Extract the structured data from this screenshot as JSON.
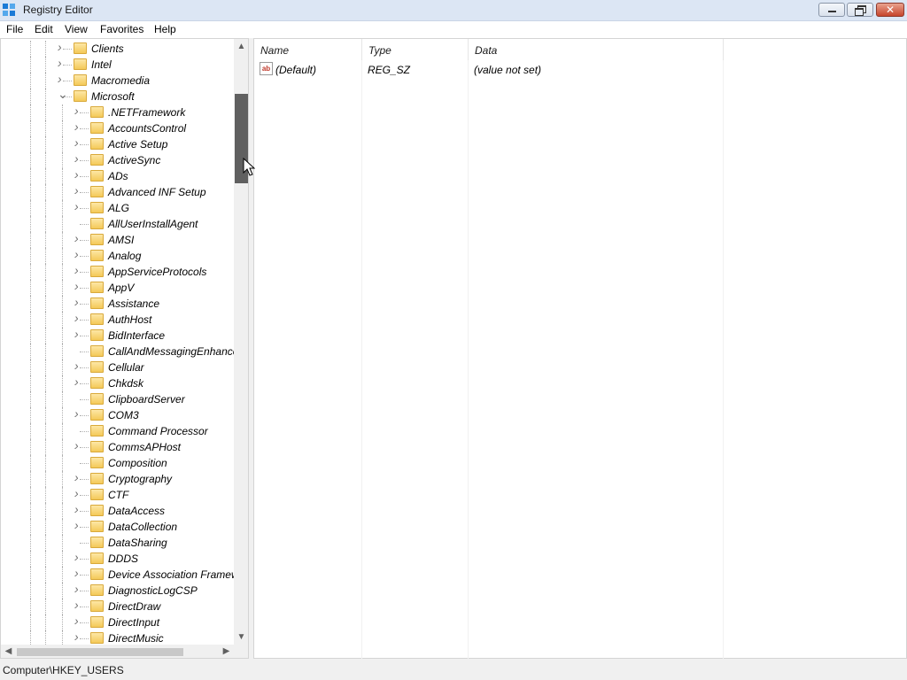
{
  "window": {
    "title": "Registry Editor",
    "close_glyph": "✕",
    "icon": "registry-editor-icon"
  },
  "menu": {
    "file": "File",
    "edit": "Edit",
    "view": "View",
    "favorites": "Favorites",
    "help": "Help"
  },
  "tree": {
    "parent_items": [
      {
        "label": "Clients",
        "state": "collapsed"
      },
      {
        "label": "Intel",
        "state": "collapsed"
      },
      {
        "label": "Macromedia",
        "state": "collapsed"
      },
      {
        "label": "Microsoft",
        "state": "expanded"
      }
    ],
    "child_items": [
      {
        "label": ".NETFramework",
        "expandable": true
      },
      {
        "label": "AccountsControl",
        "expandable": true
      },
      {
        "label": "Active Setup",
        "expandable": true
      },
      {
        "label": "ActiveSync",
        "expandable": true
      },
      {
        "label": "ADs",
        "expandable": true
      },
      {
        "label": "Advanced INF Setup",
        "expandable": true
      },
      {
        "label": "ALG",
        "expandable": true
      },
      {
        "label": "AllUserInstallAgent",
        "expandable": false
      },
      {
        "label": "AMSI",
        "expandable": true
      },
      {
        "label": "Analog",
        "expandable": true
      },
      {
        "label": "AppServiceProtocols",
        "expandable": true
      },
      {
        "label": "AppV",
        "expandable": true
      },
      {
        "label": "Assistance",
        "expandable": true
      },
      {
        "label": "AuthHost",
        "expandable": true
      },
      {
        "label": "BidInterface",
        "expandable": true
      },
      {
        "label": "CallAndMessagingEnhance",
        "expandable": false
      },
      {
        "label": "Cellular",
        "expandable": true
      },
      {
        "label": "Chkdsk",
        "expandable": true
      },
      {
        "label": "ClipboardServer",
        "expandable": false
      },
      {
        "label": "COM3",
        "expandable": true
      },
      {
        "label": "Command Processor",
        "expandable": false
      },
      {
        "label": "CommsAPHost",
        "expandable": true
      },
      {
        "label": "Composition",
        "expandable": false
      },
      {
        "label": "Cryptography",
        "expandable": true
      },
      {
        "label": "CTF",
        "expandable": true
      },
      {
        "label": "DataAccess",
        "expandable": true
      },
      {
        "label": "DataCollection",
        "expandable": true
      },
      {
        "label": "DataSharing",
        "expandable": false
      },
      {
        "label": "DDDS",
        "expandable": true
      },
      {
        "label": "Device Association Framew",
        "expandable": true
      },
      {
        "label": "DiagnosticLogCSP",
        "expandable": true
      },
      {
        "label": "DirectDraw",
        "expandable": true
      },
      {
        "label": "DirectInput",
        "expandable": true
      },
      {
        "label": "DirectMusic",
        "expandable": true
      }
    ]
  },
  "values": {
    "columns": {
      "name": "Name",
      "type": "Type",
      "data": "Data"
    },
    "rows": [
      {
        "name": "(Default)",
        "type": "REG_SZ",
        "data": "(value not set)",
        "icon": "string-value-icon",
        "icon_glyph": "ab"
      }
    ]
  },
  "status": {
    "path": "Computer\\HKEY_USERS"
  },
  "colors": {
    "folder": "#f4c958",
    "scrollbar_thumb": "#606060",
    "close_button": "#c6442b"
  }
}
